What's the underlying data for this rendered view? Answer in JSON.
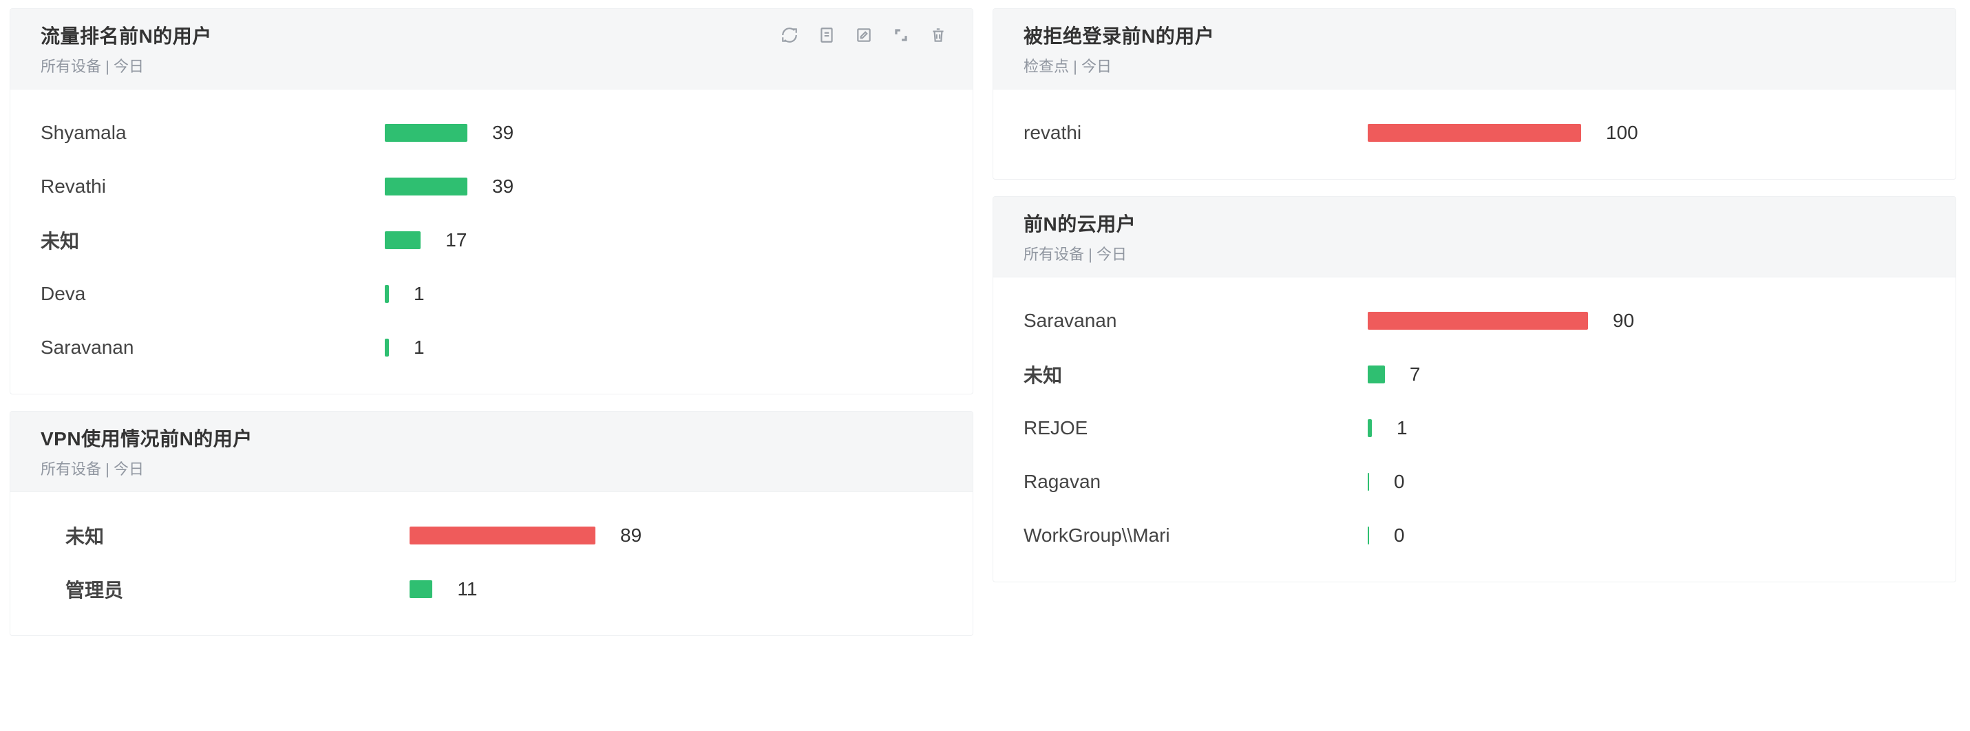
{
  "chart_data": [
    {
      "id": "traffic_top_n",
      "type": "bar",
      "title": "流量排名前N的用户",
      "subtitle": "所有设备 | 今日",
      "max": 39,
      "barMax": 120,
      "data": [
        {
          "label": "Shyamala",
          "value": 39,
          "color": "green",
          "bold": false
        },
        {
          "label": "Revathi",
          "value": 39,
          "color": "green",
          "bold": false
        },
        {
          "label": "未知",
          "value": 17,
          "color": "green",
          "bold": true
        },
        {
          "label": "Deva",
          "value": 1,
          "color": "green",
          "bold": false
        },
        {
          "label": "Saravanan",
          "value": 1,
          "color": "green",
          "bold": false
        }
      ]
    },
    {
      "id": "vpn_top_n",
      "type": "bar",
      "title": "VPN使用情况前N的用户",
      "subtitle": "所有设备 | 今日",
      "max": 89,
      "barMax": 270,
      "labelIndent": true,
      "data": [
        {
          "label": "未知",
          "value": 89,
          "color": "red",
          "bold": true
        },
        {
          "label": "管理员",
          "value": 11,
          "color": "green",
          "bold": true
        }
      ]
    },
    {
      "id": "denied_login_top_n",
      "type": "bar",
      "title": "被拒绝登录前N的用户",
      "subtitle": "检查点 | 今日",
      "max": 100,
      "barMax": 310,
      "data": [
        {
          "label": "revathi",
          "value": 100,
          "color": "red",
          "bold": false
        }
      ]
    },
    {
      "id": "cloud_top_n",
      "type": "bar",
      "title": "前N的云用户",
      "subtitle": "所有设备 | 今日",
      "max": 90,
      "barMax": 320,
      "data": [
        {
          "label": "Saravanan",
          "value": 90,
          "color": "red",
          "bold": false
        },
        {
          "label": "未知",
          "value": 7,
          "color": "green",
          "bold": true
        },
        {
          "label": "REJOE",
          "value": 1,
          "color": "green",
          "bold": false
        },
        {
          "label": "Ragavan",
          "value": 0,
          "color": "green",
          "bold": false
        },
        {
          "label": "WorkGroup\\\\Mari",
          "value": 0,
          "color": "green",
          "bold": false
        }
      ]
    }
  ],
  "toolbar_icons": [
    "refresh",
    "export",
    "edit",
    "expand",
    "delete"
  ]
}
